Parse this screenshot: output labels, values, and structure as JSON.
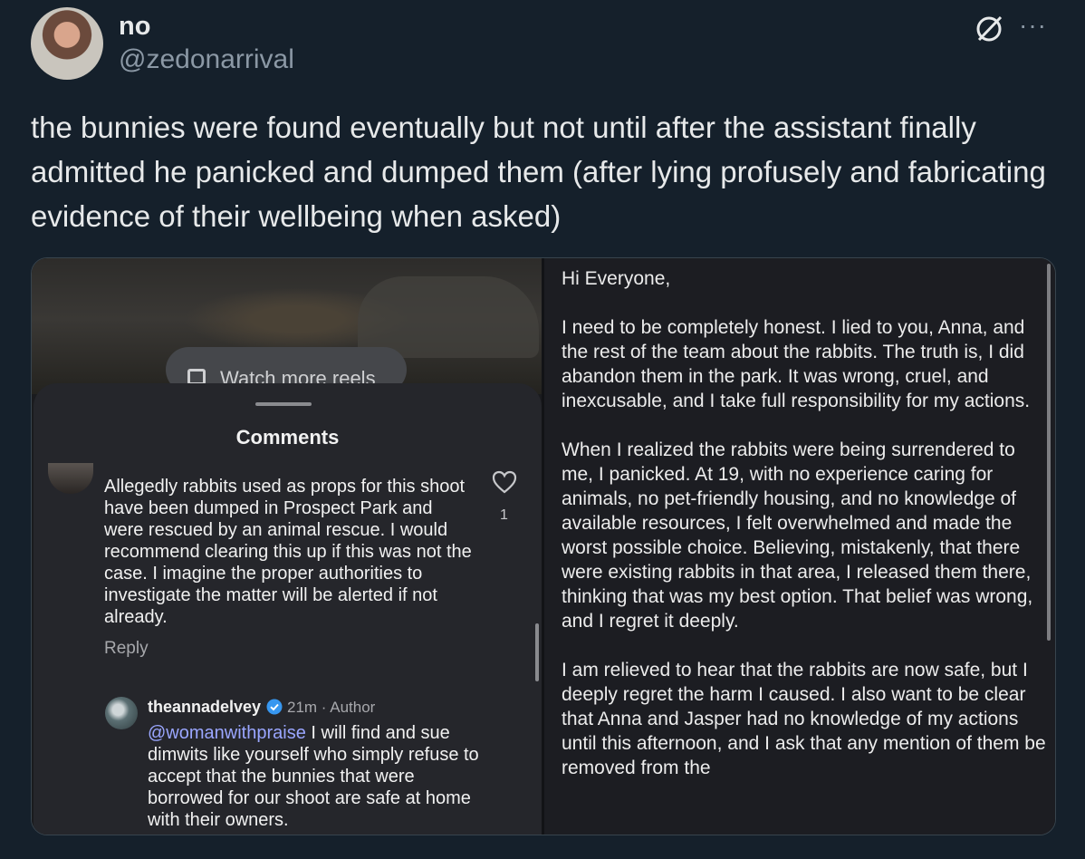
{
  "tweet": {
    "display_name": "no",
    "handle": "@zedonarrival",
    "text": "the bunnies were found eventually but not until after the assistant finally admitted he panicked and dumped them (after lying profusely and fabricating evidence of their wellbeing when asked)",
    "more_label": "···"
  },
  "left_panel": {
    "reel_button": "Watch more reels",
    "comments_title": "Comments",
    "comment": {
      "text": "Allegedly rabbits used as props for this shoot have been dumped in Prospect Park and were rescued by an animal rescue. I would recommend clearing this up if this was not the case. I imagine the proper authorities to investigate the matter will be alerted if not already.",
      "likes": "1",
      "reply_label": "Reply"
    },
    "reply": {
      "author": "theannadelvey",
      "meta": "21m · Author",
      "mention": "@womanwithpraise",
      "text": " I will find and sue dimwits like yourself who simply refuse to accept that the bunnies that were borrowed for our shoot are safe at home with their owners."
    }
  },
  "right_panel": {
    "paragraphs": [
      "Hi Everyone,",
      "I need to be completely honest. I lied to you, Anna, and the rest of the team about the rabbits. The truth is, I did abandon them in the park. It was wrong, cruel, and inexcusable, and I take full responsibility for my actions.",
      "When I realized the rabbits were being surrendered to me, I panicked. At 19, with no experience caring for animals, no pet-friendly housing, and no knowledge of available resources, I felt overwhelmed and made the worst possible choice. Believing, mistakenly, that there were existing rabbits in that area, I released them there, thinking that was my best option. That belief was wrong, and I regret it deeply.",
      "I am relieved to hear that the rabbits are now safe, but I deeply regret the harm I caused. I also want to be clear that Anna and Jasper had no knowledge of my actions until this afternoon, and I ask that any mention of them be removed from the"
    ]
  },
  "colors": {
    "background": "#15202b",
    "secondary_text": "#8b98a5",
    "mention": "#9aa6ff",
    "verified": "#3797f0"
  }
}
